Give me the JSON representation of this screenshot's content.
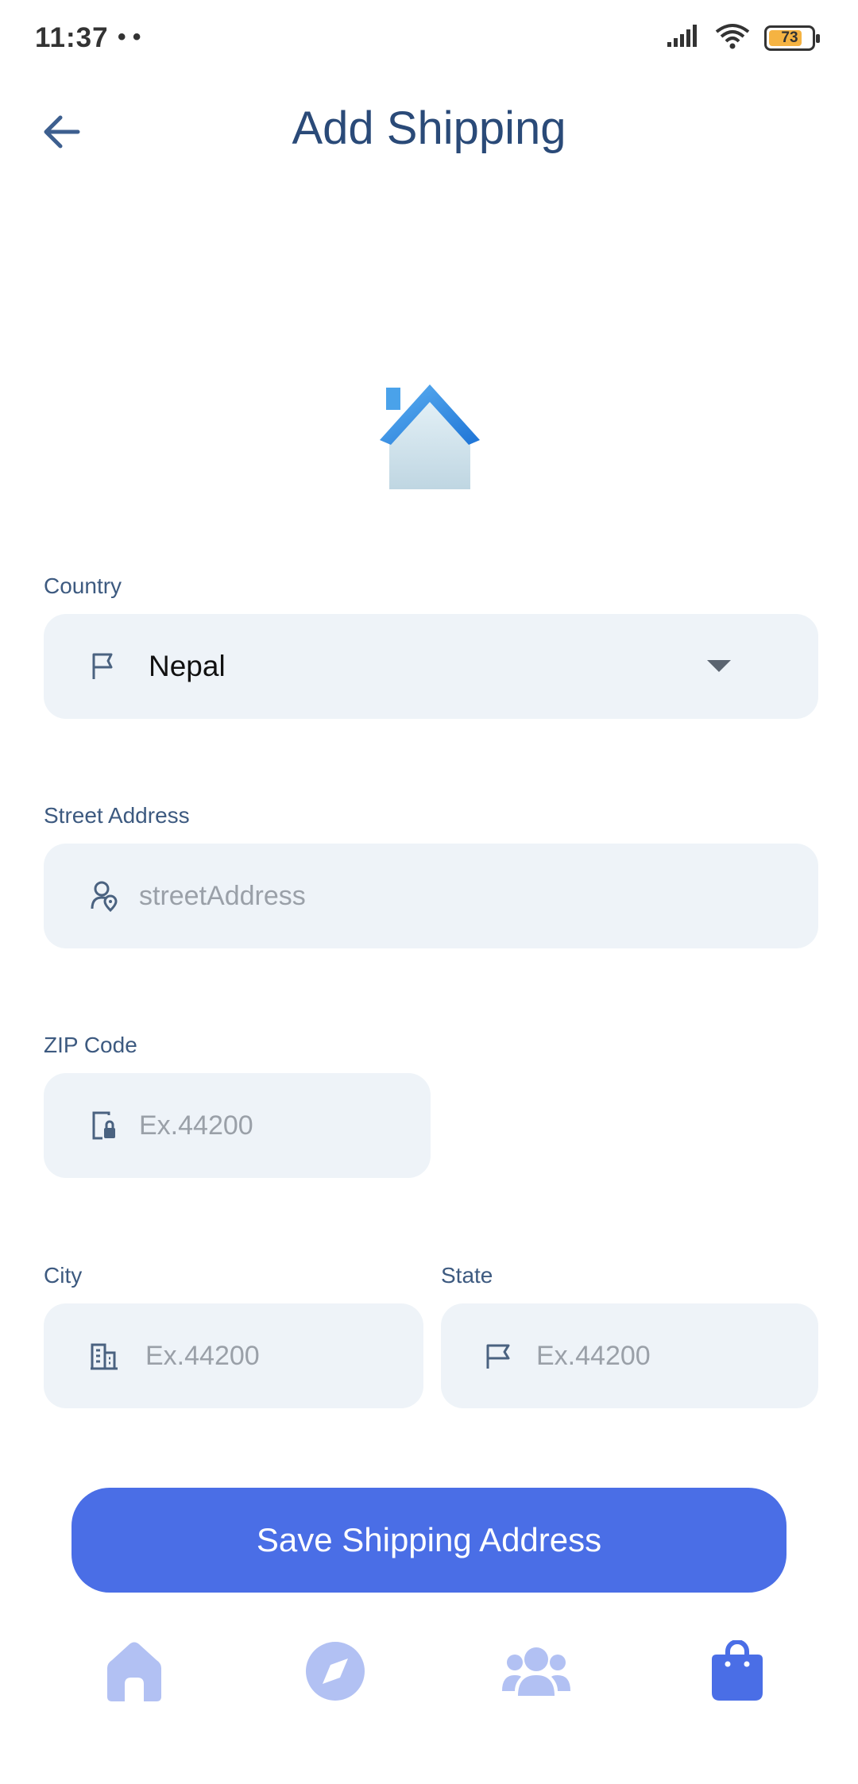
{
  "status_bar": {
    "time": "11:37",
    "misc": "•  •",
    "battery": "73"
  },
  "header": {
    "title": "Add Shipping",
    "back_icon": "arrow-left-icon"
  },
  "illustration": {
    "icon": "house-icon"
  },
  "form": {
    "country": {
      "label": "Country",
      "value": "Nepal",
      "icon": "flag-icon"
    },
    "street": {
      "label": "Street Address",
      "placeholder": "streetAddress",
      "icon": "user-location-icon"
    },
    "zip": {
      "label": "ZIP Code",
      "placeholder": "Ex.44200",
      "icon": "lock-document-icon"
    },
    "city": {
      "label": "City",
      "placeholder": "Ex.44200",
      "icon": "building-icon"
    },
    "state": {
      "label": "State",
      "placeholder": "Ex.44200",
      "icon": "flag-icon"
    }
  },
  "save_button": {
    "label": "Save Shipping Address"
  },
  "bottom_nav": {
    "items": [
      {
        "icon": "home-icon",
        "active": false
      },
      {
        "icon": "compass-icon",
        "active": false
      },
      {
        "icon": "community-icon",
        "active": false
      },
      {
        "icon": "shopping-bag-icon",
        "active": true
      }
    ]
  },
  "colors": {
    "primary": "#4a6ee6",
    "title": "#2a4a78",
    "field_bg": "#eef3f8",
    "nav_inactive": "#b2c1f3"
  }
}
